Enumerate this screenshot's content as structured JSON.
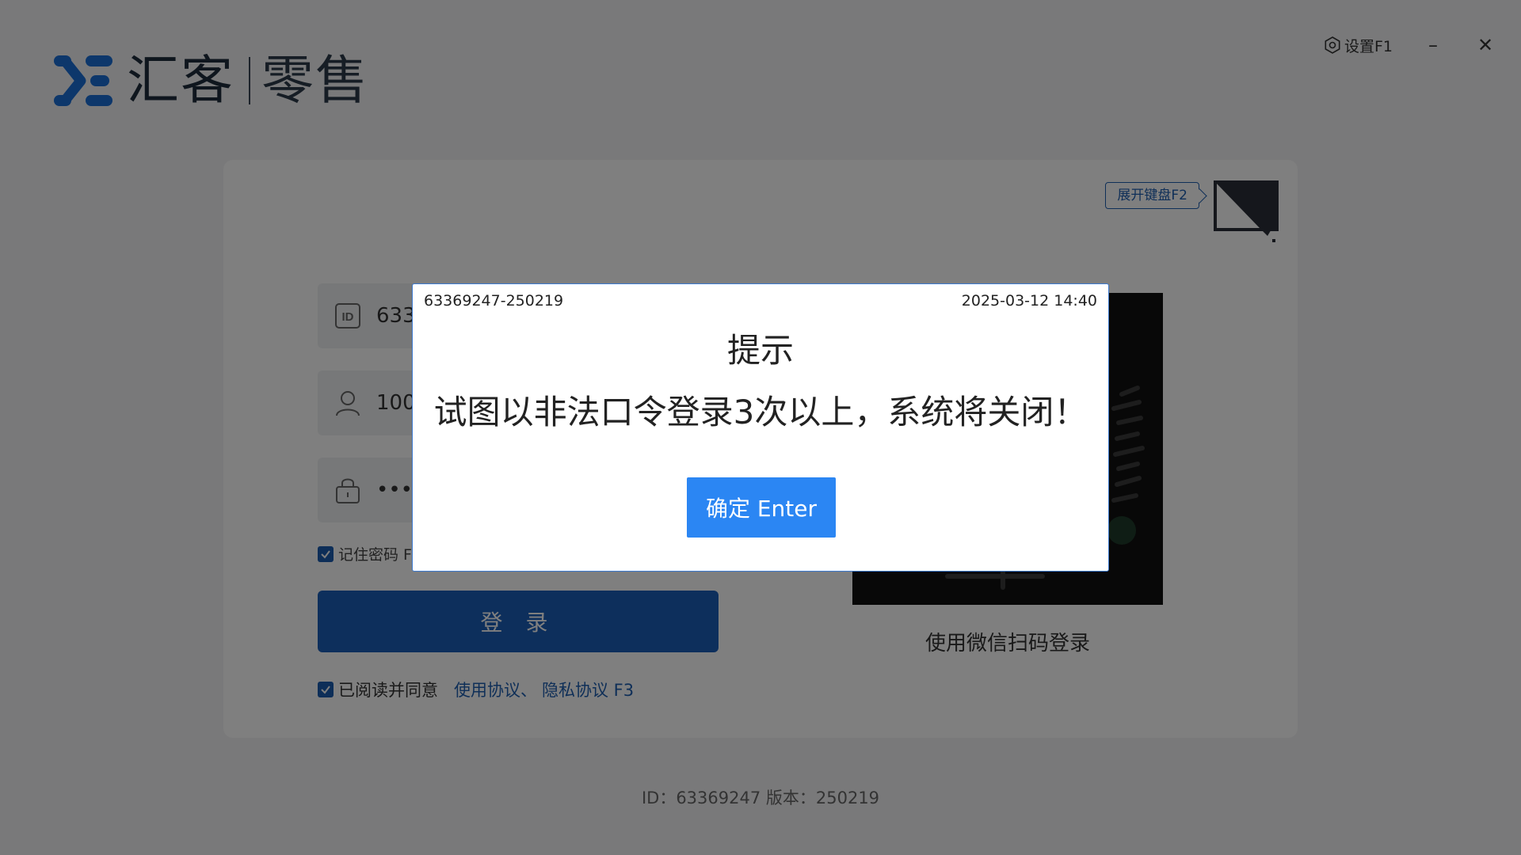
{
  "header": {
    "logo_text_a": "汇客",
    "logo_text_b": "零售",
    "settings_label": "设置F1",
    "minimize_symbol": "–",
    "close_symbol": "✕"
  },
  "login": {
    "keyboard_tag": "展开键盘F2",
    "id_value": "633",
    "user_value": "100",
    "password_value": "••••",
    "remember_label": "记住密码 F",
    "login_button": "登 录",
    "agree_text": "已阅读并同意",
    "agree_link_1": "使用协议、",
    "agree_link_2": "隐私协议 F3",
    "qr_caption": "使用微信扫码登录"
  },
  "footer": {
    "text": "ID：63369247  版本：250219"
  },
  "modal": {
    "id_text": "63369247-250219",
    "time_text": "2025-03-12 14:40",
    "title": "提示",
    "message": "试图以非法口令登录3次以上，系统将关闭！",
    "confirm_button": "确定 Enter"
  },
  "colors": {
    "primary": "#1a5eb8",
    "modal_button": "#2b86f3",
    "overlay": "rgba(0,0,0,0.5)"
  },
  "icons": [
    "logo-icon",
    "gear-icon",
    "minimize-icon",
    "close-icon",
    "id-card-icon",
    "user-icon",
    "lock-icon",
    "checkbox-icon",
    "monitor-corner-icon",
    "qr-code"
  ]
}
